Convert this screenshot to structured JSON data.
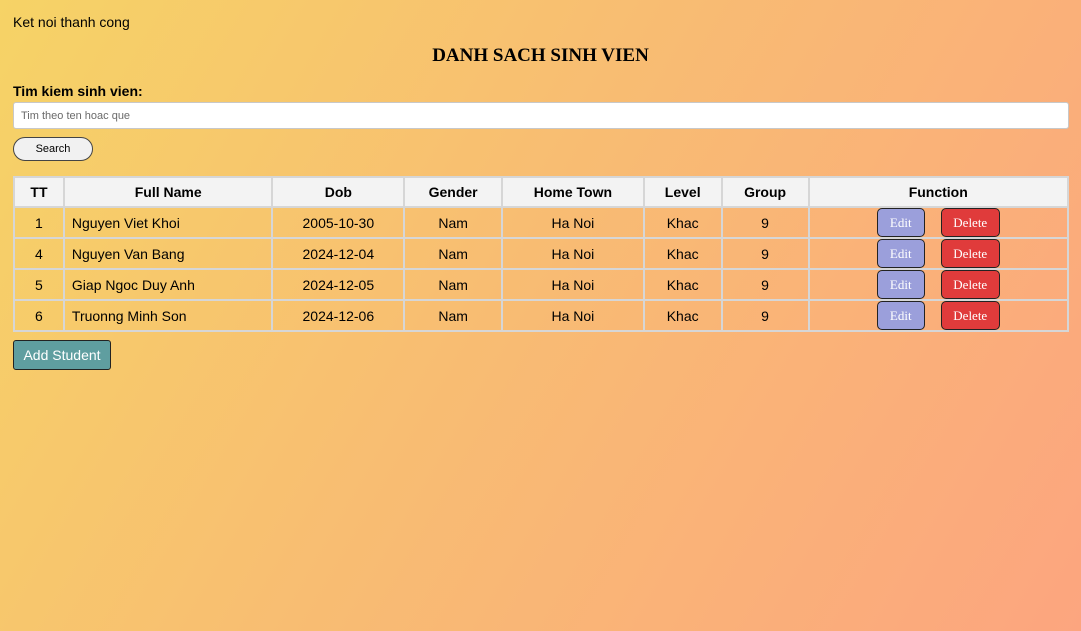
{
  "status": "Ket noi thanh cong",
  "title": "DANH SACH SINH VIEN",
  "search": {
    "label": "Tim kiem sinh vien:",
    "placeholder": "Tim theo ten hoac que",
    "value": "",
    "button_label": "Search"
  },
  "table": {
    "columns": [
      "TT",
      "Full Name",
      "Dob",
      "Gender",
      "Home Town",
      "Level",
      "Group",
      "Function"
    ],
    "rows": [
      [
        "1",
        "Nguyen Viet Khoi",
        "2005-10-30",
        "Nam",
        "Ha Noi",
        "Khac",
        "9"
      ],
      [
        "4",
        "Nguyen Van Bang",
        "2024-12-04",
        "Nam",
        "Ha Noi",
        "Khac",
        "9"
      ],
      [
        "5",
        "Giap Ngoc Duy Anh",
        "2024-12-05",
        "Nam",
        "Ha Noi",
        "Khac",
        "9"
      ],
      [
        "6",
        "Truonng Minh Son",
        "2024-12-06",
        "Nam",
        "Ha Noi",
        "Khac",
        "9"
      ]
    ],
    "edit_label": "Edit",
    "delete_label": "Delete"
  },
  "add_button_label": "Add Student",
  "colors": {
    "edit_button": "#9b9fdb",
    "delete_button": "#e03b3b",
    "add_button": "#5f9ea0",
    "background_start": "#f6d366",
    "background_end": "#fca57f"
  }
}
